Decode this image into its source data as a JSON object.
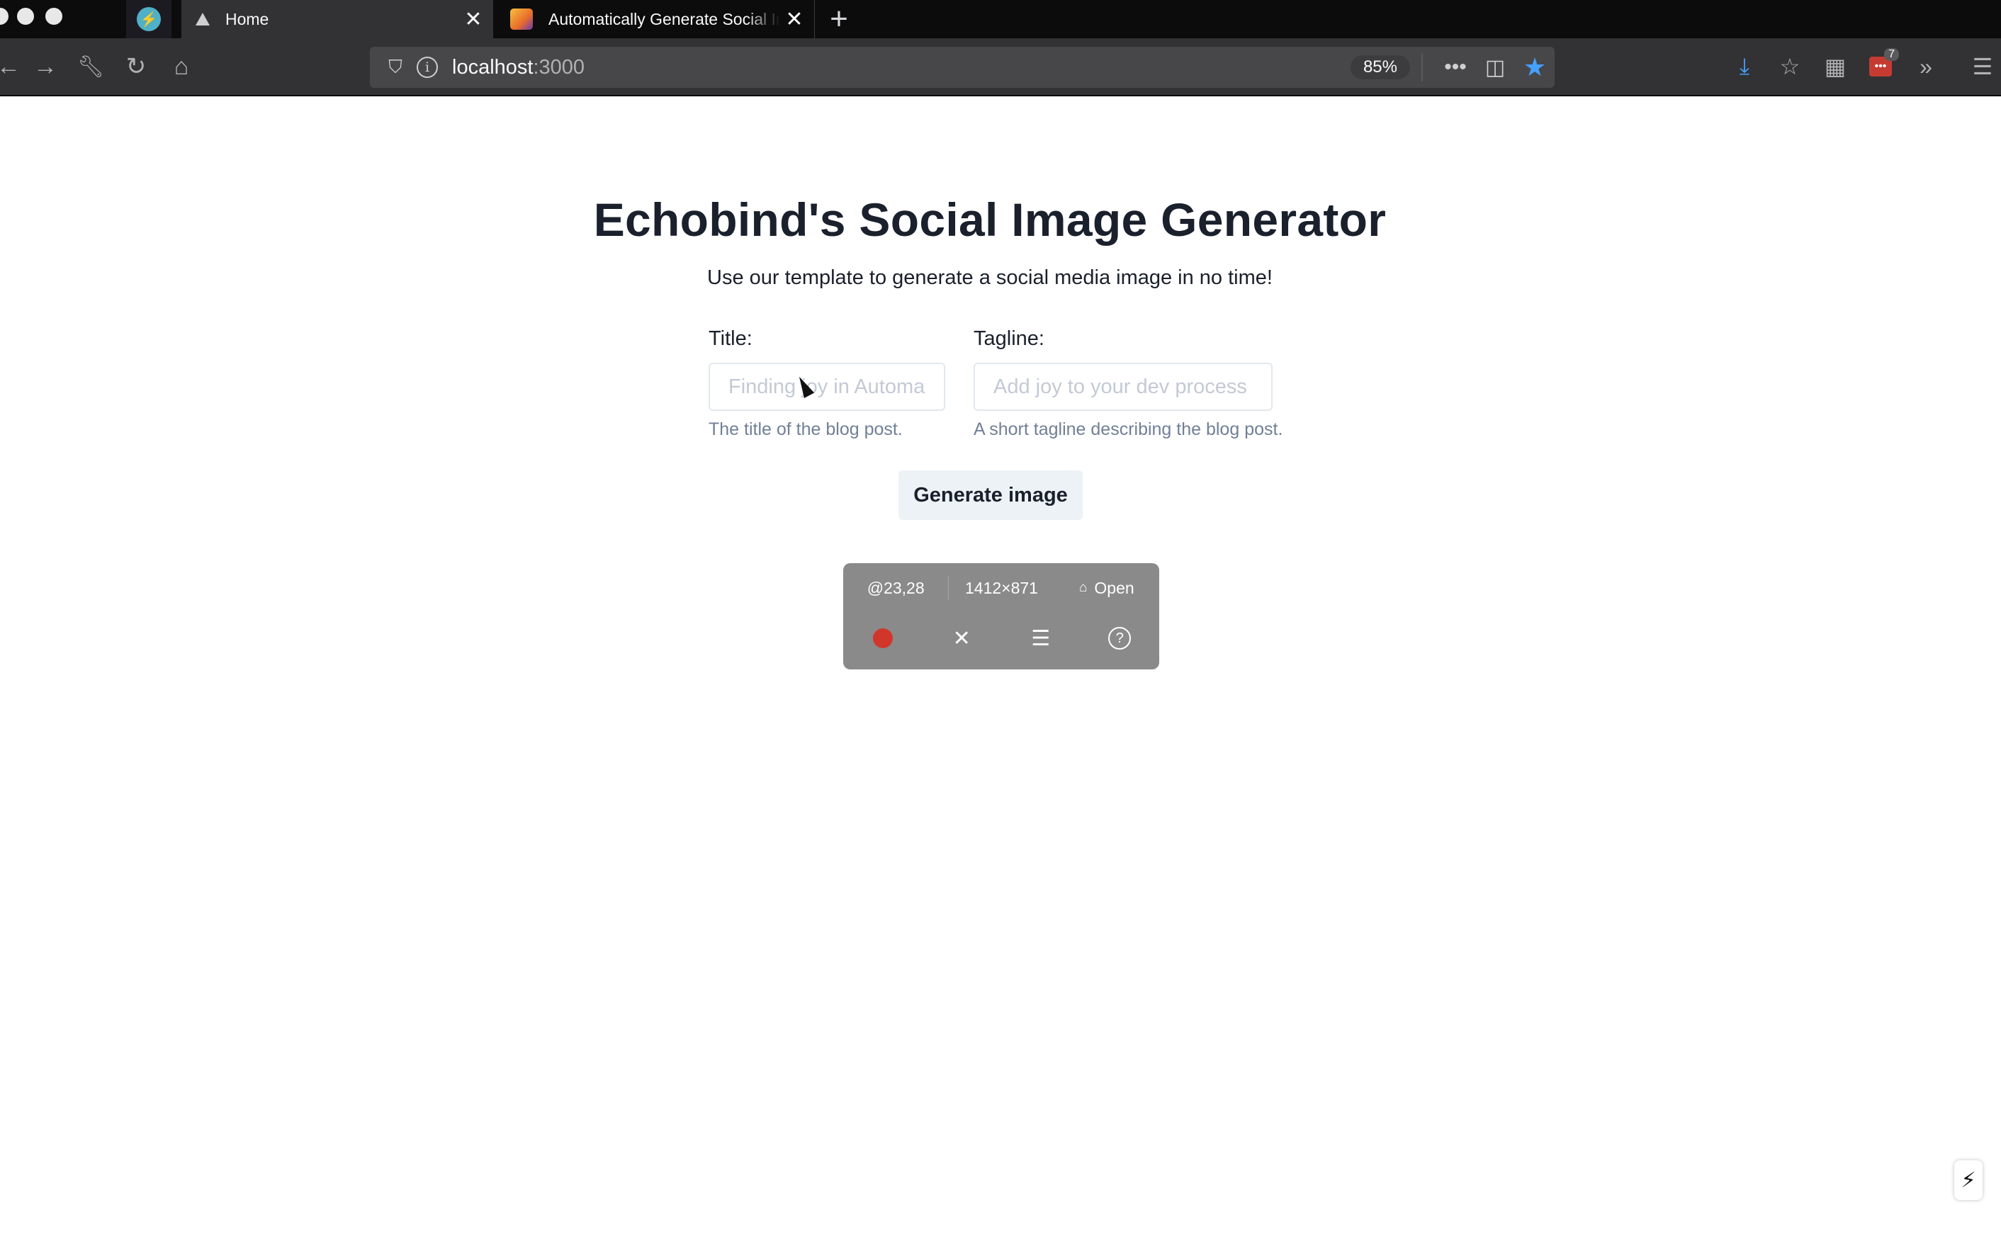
{
  "browser": {
    "tabs": [
      {
        "title": "",
        "pinned": true,
        "favicon": "lightning-favicon",
        "active": false
      },
      {
        "title": "Home",
        "favicon": "vercel-triangle-favicon",
        "active": true
      },
      {
        "title": "Automatically Generate Social Images",
        "favicon": "emoji-image-favicon",
        "active": false
      }
    ],
    "tab_close_glyph": "✕",
    "new_tab_glyph": "+",
    "url": {
      "host": "localhost",
      "port": ":3000"
    },
    "zoom": "85%",
    "extension_badge": "7",
    "icons": {
      "back": "back-arrow-icon",
      "forward": "forward-arrow-icon",
      "customize": "wrench-icon",
      "reload": "reload-icon",
      "home": "home-icon",
      "tracking": "shield-icon",
      "site_info": "info-icon",
      "page_actions": "ellipsis-icon",
      "pocket": "pocket-icon",
      "bookmark": "star-icon",
      "downloads": "download-icon",
      "library": "library-icon",
      "apps": "grid-icon",
      "extension": "extension-icon",
      "overflow": "chevron-double-right-icon",
      "menu": "hamburger-icon"
    }
  },
  "page": {
    "title": "Echobind's Social Image Generator",
    "subtitle": "Use our template to generate a social media image in no time!",
    "fields": [
      {
        "label": "Title:",
        "placeholder": "Finding joy in Automation",
        "value": "",
        "help": "The title of the blog post."
      },
      {
        "label": "Tagline:",
        "placeholder": "Add joy to your dev process with automation",
        "value": "",
        "help": "A short tagline describing the blog post."
      }
    ],
    "submit_label": "Generate image"
  },
  "capture_hud": {
    "position": "@23,28",
    "size": "1412×871",
    "mode": "Open",
    "lock_icon": "lock-open-icon",
    "record_icon": "record-dot-icon",
    "close_icon": "close-icon",
    "settings_icon": "sliders-icon",
    "help_icon": "help-icon"
  },
  "colors": {
    "heading": "#1a202c",
    "help_text": "#718096",
    "button_bg": "#edf2f7",
    "input_border": "#e2e8f0",
    "chrome_dark": "#0c0c0d",
    "toolbar": "#323234",
    "accent": "#45a1ff",
    "record": "#d2362b"
  }
}
